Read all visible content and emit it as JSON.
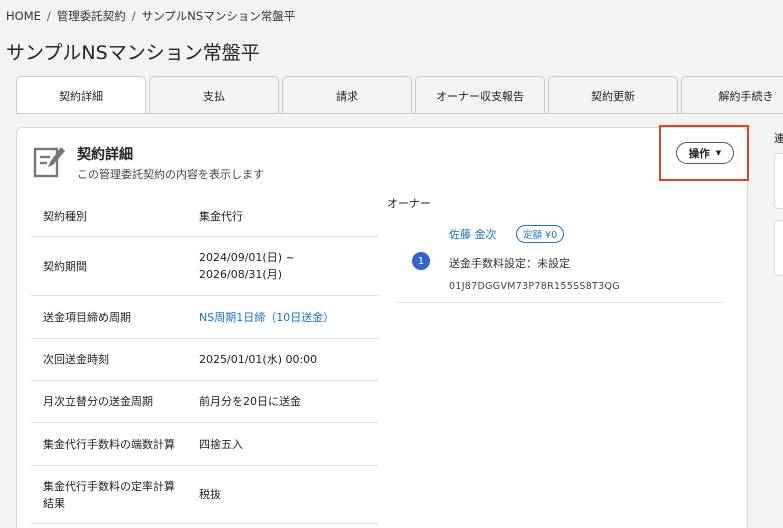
{
  "breadcrumb": {
    "items": [
      "HOME",
      "管理委託契約",
      "サンプルNSマンション常盤平"
    ],
    "separator": "/"
  },
  "page": {
    "title": "サンプルNSマンション常盤平"
  },
  "tabs": [
    {
      "label": "契約詳細",
      "active": true
    },
    {
      "label": "支払",
      "active": false
    },
    {
      "label": "請求",
      "active": false
    },
    {
      "label": "オーナー収支報告",
      "active": false
    },
    {
      "label": "契約更新",
      "active": false
    },
    {
      "label": "解約手続き",
      "active": false
    }
  ],
  "card": {
    "title": "契約詳細",
    "subtitle": "この管理委託契約の内容を表示します",
    "action_label": "操作",
    "rows": [
      {
        "label": "契約種別",
        "value": "集金代行"
      },
      {
        "label": "契約期間",
        "value": "2024/09/01(日) ~\n2026/08/31(月)"
      },
      {
        "label": "送金項目締め周期",
        "value": "NS周期1日締（10日送金）",
        "link": true
      },
      {
        "label": "次回送金時刻",
        "value": "2025/01/01(水) 00:00"
      },
      {
        "label": "月次立替分の送金周期",
        "value": "前月分を20日に送金"
      },
      {
        "label": "集金代行手数料の端数計算",
        "value": "四捨五入"
      },
      {
        "label": "集金代行手数料の定率計算\n結果",
        "value": "税抜"
      }
    ]
  },
  "owner": {
    "heading": "オーナー",
    "name": "佐藤 金次",
    "badge": "定額 ¥0",
    "number": "1",
    "setting": "送金手数料設定：未設定",
    "id": "01J87DGGVM73P78R155SS8T3QG"
  },
  "right_panel": {
    "label": "連"
  },
  "colors": {
    "accent": "#1a73c8",
    "highlight": "#e0431f",
    "badge_bg": "#2f66c9"
  }
}
